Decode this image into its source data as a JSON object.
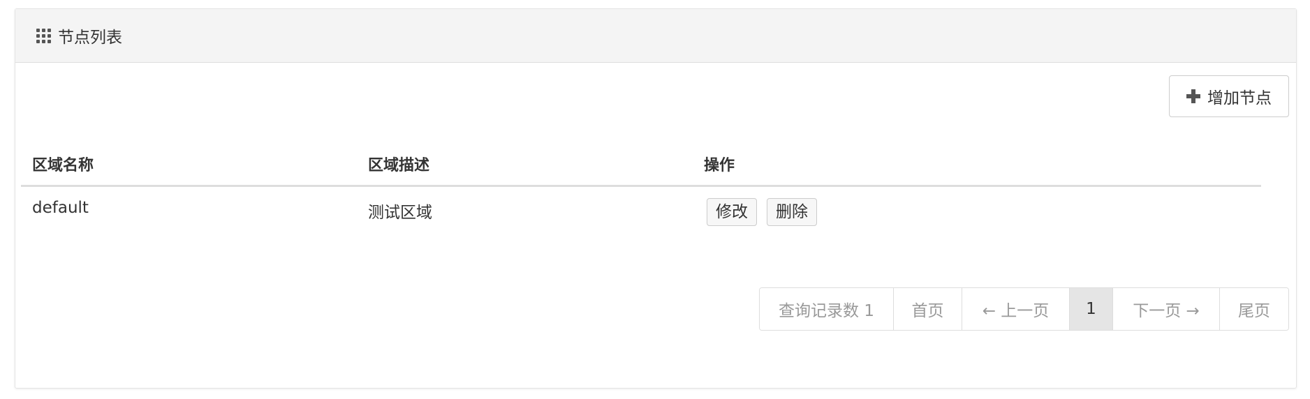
{
  "panel": {
    "title": "节点列表",
    "title_icon": "grid-icon"
  },
  "toolbar": {
    "add_label": "增加节点",
    "add_icon": "plus-icon"
  },
  "table": {
    "headers": [
      "区域名称",
      "区域描述",
      "操作"
    ],
    "rows": [
      {
        "name": "default",
        "description": "测试区域",
        "actions": [
          "修改",
          "删除"
        ]
      }
    ]
  },
  "pagination": {
    "record_count_label": "查询记录数 1",
    "first": "首页",
    "prev": "← 上一页",
    "current": "1",
    "next": "下一页 →",
    "last": "尾页"
  },
  "colors": {
    "header_bg": "#f4f4f4",
    "active_page_bg": "#e5e5e5",
    "muted_text": "#999999"
  }
}
